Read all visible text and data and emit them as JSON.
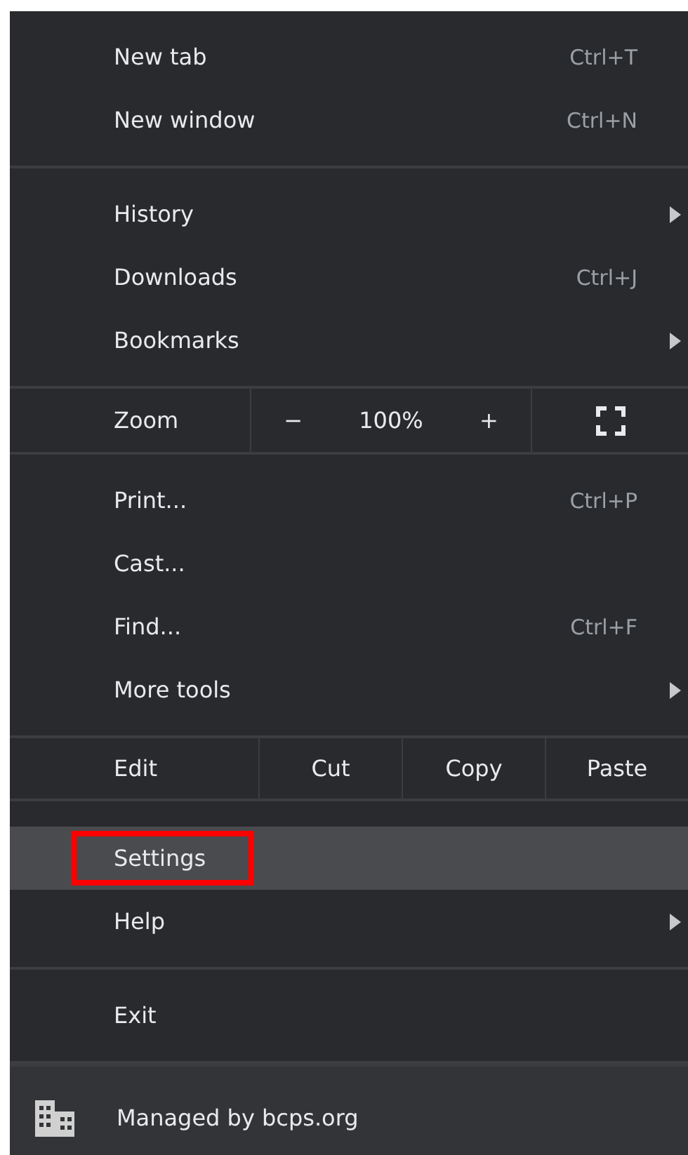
{
  "sections": [
    {
      "kind": "items",
      "items": [
        {
          "label": "New tab",
          "shortcut": "Ctrl+T",
          "submenu": false,
          "selected": false,
          "highlighted": false
        },
        {
          "label": "New window",
          "shortcut": "Ctrl+N",
          "submenu": false,
          "selected": false,
          "highlighted": false
        }
      ]
    },
    {
      "kind": "items",
      "items": [
        {
          "label": "History",
          "submenu": true,
          "selected": false,
          "highlighted": false
        },
        {
          "label": "Downloads",
          "shortcut": "Ctrl+J",
          "submenu": false,
          "selected": false,
          "highlighted": false
        },
        {
          "label": "Bookmarks",
          "submenu": true,
          "selected": false,
          "highlighted": false
        }
      ]
    },
    {
      "kind": "zoom",
      "label": "Zoom",
      "minus": "−",
      "value": "100%",
      "plus": "+"
    },
    {
      "kind": "items",
      "items": [
        {
          "label": "Print...",
          "shortcut": "Ctrl+P",
          "submenu": false,
          "selected": false,
          "highlighted": false
        },
        {
          "label": "Cast...",
          "submenu": false,
          "selected": false,
          "highlighted": false
        },
        {
          "label": "Find...",
          "shortcut": "Ctrl+F",
          "submenu": false,
          "selected": false,
          "highlighted": false
        },
        {
          "label": "More tools",
          "submenu": true,
          "selected": false,
          "highlighted": false
        }
      ]
    },
    {
      "kind": "edit",
      "label": "Edit",
      "buttons": [
        "Cut",
        "Copy",
        "Paste"
      ]
    },
    {
      "kind": "items",
      "items": [
        {
          "label": "Settings",
          "submenu": false,
          "selected": true,
          "highlighted": true
        },
        {
          "label": "Help",
          "submenu": true,
          "selected": false,
          "highlighted": false
        }
      ]
    },
    {
      "kind": "items",
      "items": [
        {
          "label": "Exit",
          "submenu": false,
          "selected": false,
          "highlighted": false
        }
      ]
    },
    {
      "kind": "footer",
      "label": "Managed by bcps.org"
    }
  ]
}
